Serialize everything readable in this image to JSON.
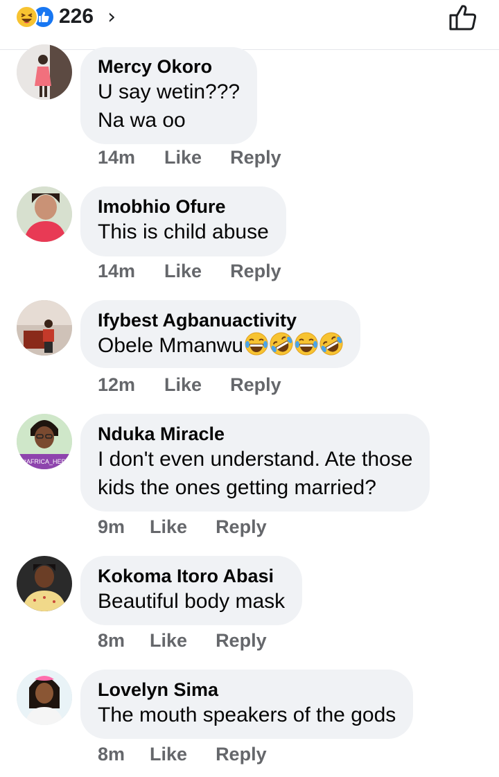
{
  "reactions": {
    "count": "226",
    "types": [
      "haha-icon",
      "like-icon"
    ],
    "chevron": "›"
  },
  "comments": [
    {
      "author": "Mercy Okoro",
      "text": "U say wetin???\nNa wa oo",
      "time": "14m",
      "like": "Like",
      "reply": "Reply"
    },
    {
      "author": "Imobhio Ofure",
      "text": "This is child abuse",
      "time": "14m",
      "like": "Like",
      "reply": "Reply"
    },
    {
      "author": "Ifybest Agbanuactivity",
      "text": "Obele Mmanwu",
      "emojis": [
        "tears-of-joy-emoji",
        "rofl-emoji",
        "tears-of-joy-emoji",
        "rofl-emoji"
      ],
      "time": "12m",
      "like": "Like",
      "reply": "Reply"
    },
    {
      "author": "Nduka Miracle",
      "text": "I don't even understand. Ate those\nkids the ones getting married?",
      "avatar_caption": "#AFRICA_HER",
      "time": "9m",
      "like": "Like",
      "reply": "Reply"
    },
    {
      "author": "Kokoma Itoro Abasi",
      "text": "Beautiful body mask",
      "time": "8m",
      "like": "Like",
      "reply": "Reply"
    },
    {
      "author": "Lovelyn Sima",
      "text": "The mouth speakers of the gods",
      "time": "8m",
      "like": "Like",
      "reply": "Reply"
    }
  ],
  "colors": {
    "bubble": "#f0f2f5",
    "meta_text": "#65676b",
    "like_blue": "#1877f2",
    "haha_yellow": "#f7c331"
  }
}
